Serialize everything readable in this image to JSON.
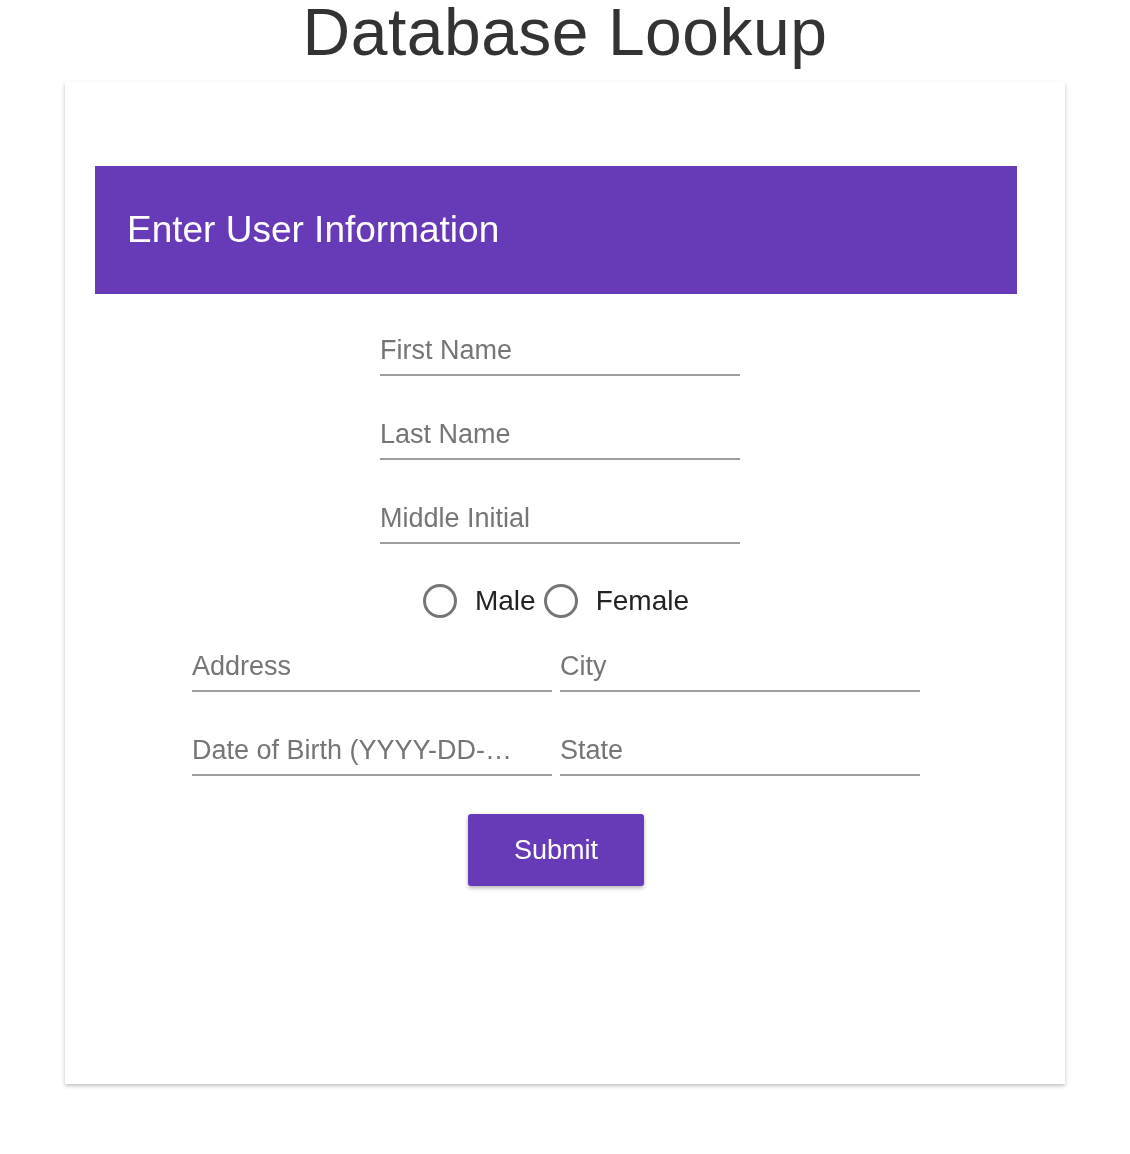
{
  "page_title": "Database Lookup",
  "form": {
    "header": "Enter User Information",
    "rows": [
      {
        "kind": "fields",
        "fields": [
          {
            "placeholder": "First Name"
          }
        ]
      },
      {
        "kind": "fields",
        "fields": [
          {
            "placeholder": "Last Name"
          }
        ]
      },
      {
        "kind": "fields",
        "fields": [
          {
            "placeholder": "Middle Initial"
          }
        ]
      },
      {
        "kind": "radios",
        "options": [
          {
            "label": "Male",
            "selected": false
          },
          {
            "label": "Female",
            "selected": false
          }
        ]
      },
      {
        "kind": "fields",
        "fields": [
          {
            "placeholder": "Address"
          },
          {
            "placeholder": "City"
          }
        ]
      },
      {
        "kind": "fields",
        "fields": [
          {
            "placeholder": "Date of Birth (YYYY-DD-…"
          },
          {
            "placeholder": "State"
          }
        ]
      }
    ],
    "submit": "Submit"
  }
}
